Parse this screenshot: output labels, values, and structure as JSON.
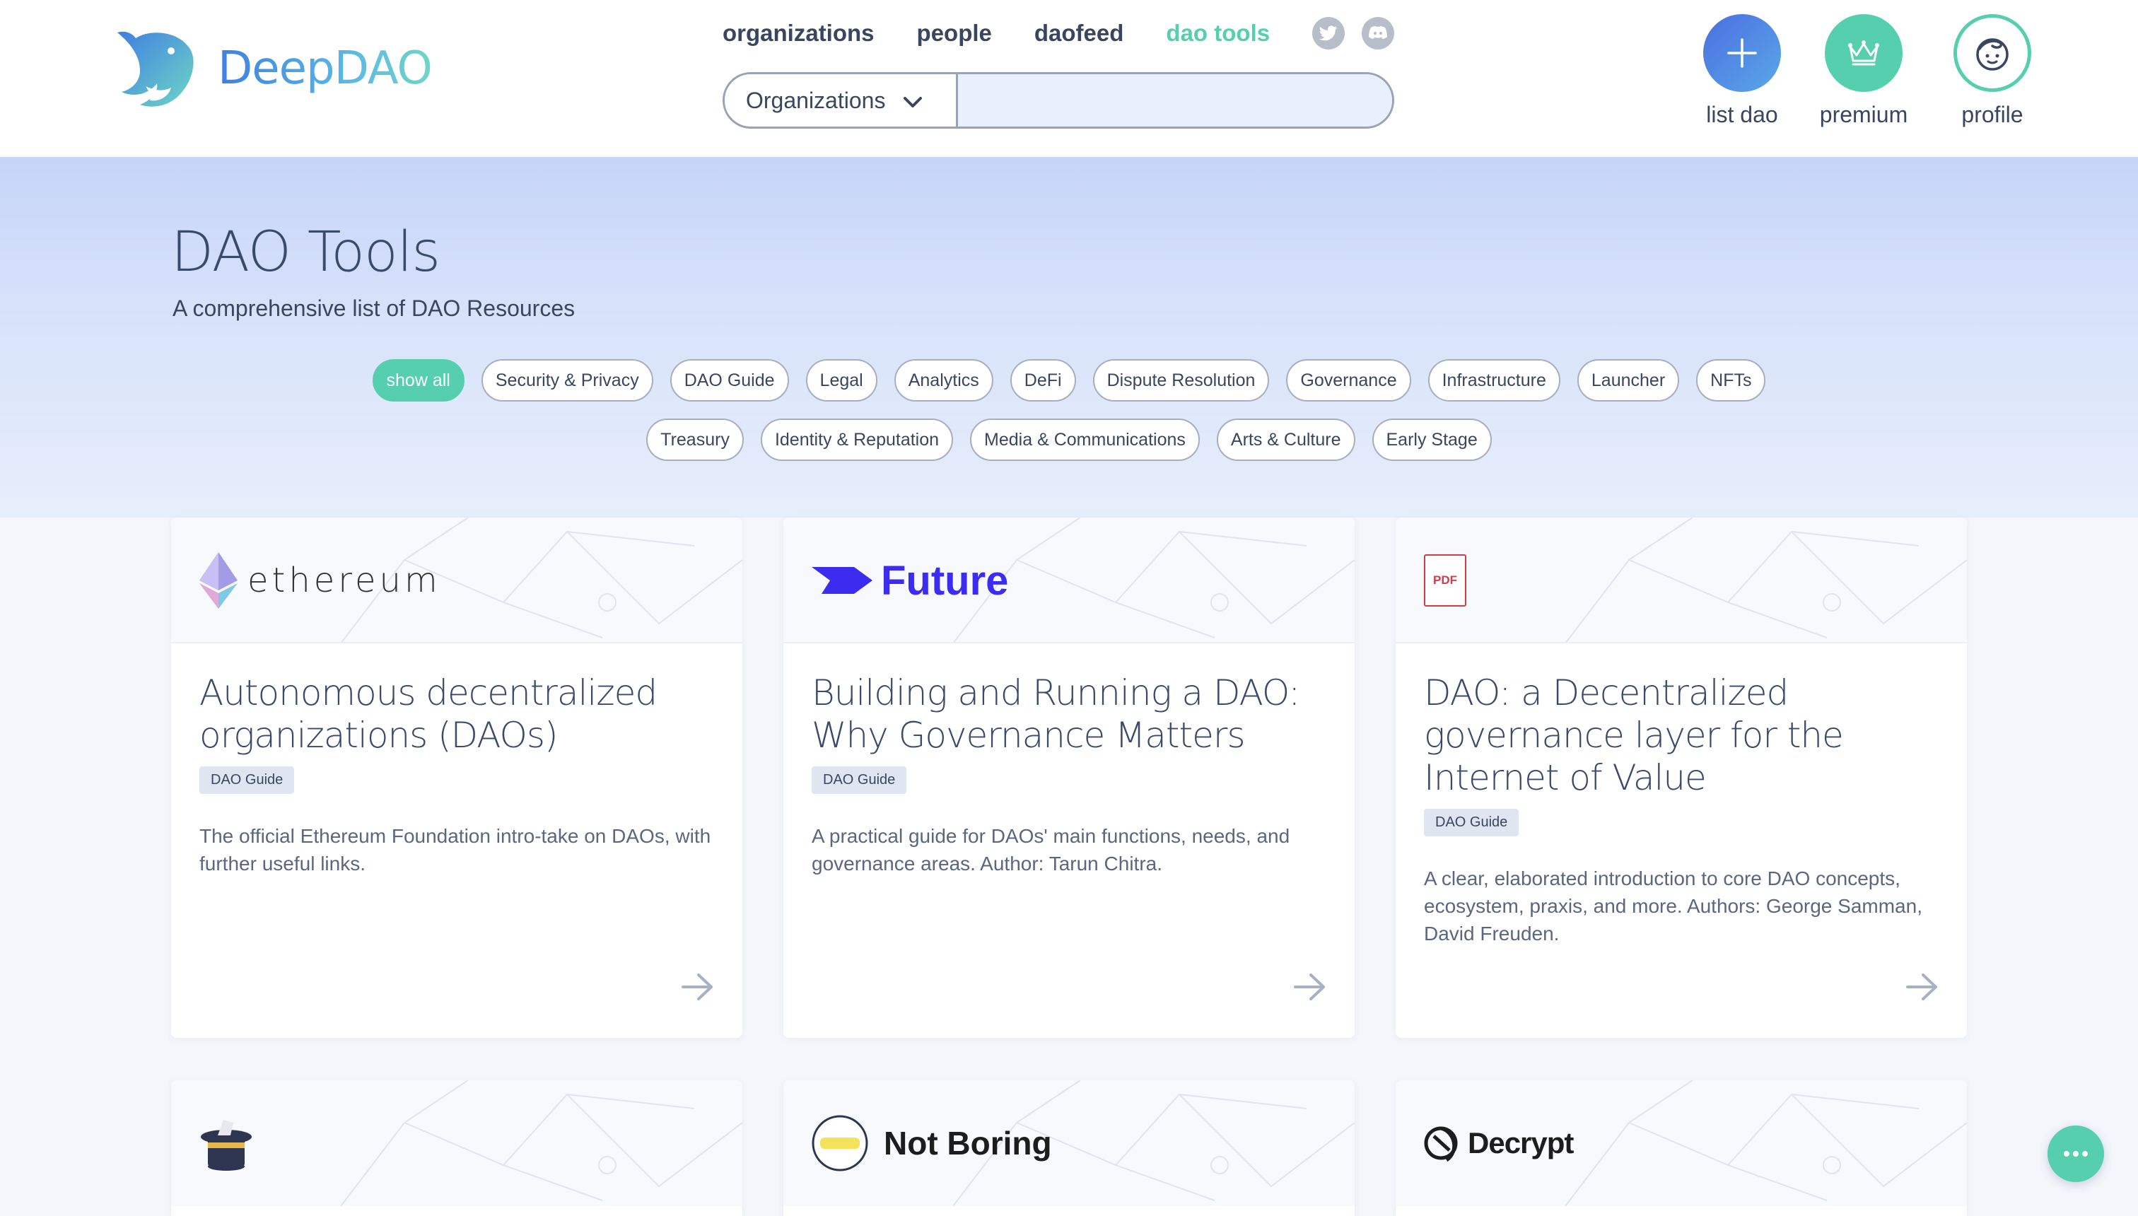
{
  "brand": {
    "name": "DeepDAO"
  },
  "nav": {
    "links": [
      "organizations",
      "people",
      "daofeed",
      "dao tools"
    ],
    "active": "dao tools",
    "social": [
      "twitter-icon",
      "discord-icon"
    ]
  },
  "search": {
    "scope": "Organizations",
    "query": "",
    "placeholder": ""
  },
  "actions": {
    "list": "list dao",
    "premium": "premium",
    "profile": "profile"
  },
  "hero": {
    "title": "DAO Tools",
    "subtitle": "A comprehensive list of DAO Resources"
  },
  "filters": {
    "row1": [
      "show all",
      "Security & Privacy",
      "DAO Guide",
      "Legal",
      "Analytics",
      "DeFi",
      "Dispute Resolution",
      "Governance",
      "Infrastructure",
      "Launcher",
      "NFTs"
    ],
    "row2": [
      "Treasury",
      "Identity & Reputation",
      "Media & Communications",
      "Arts & Culture",
      "Early Stage"
    ],
    "active": "show all"
  },
  "cards": [
    {
      "source": "ethereum",
      "title": "Autonomous decentralized organizations (DAOs)",
      "tag": "DAO Guide",
      "description": "The official Ethereum Foundation intro-take on DAOs, with further useful links."
    },
    {
      "source": "Future",
      "title": "Building and Running a DAO: Why Governance Matters",
      "tag": "DAO Guide",
      "description": "A practical guide for DAOs' main functions, needs, and governance areas. Author: Tarun Chitra."
    },
    {
      "source": "PDF",
      "title": "DAO: a Decentralized governance layer for the Internet of Value",
      "tag": "DAO Guide",
      "description": "A clear, elaborated introduction to core DAO concepts, ecosystem, praxis, and more. Authors: George Samman, David Freuden."
    },
    {
      "source": "magic-hat"
    },
    {
      "source": "Not Boring"
    },
    {
      "source": "Decrypt"
    }
  ],
  "colors": {
    "accent": "#55cfae",
    "brand_blue": "#3f7fe0",
    "text": "#3a4660"
  }
}
